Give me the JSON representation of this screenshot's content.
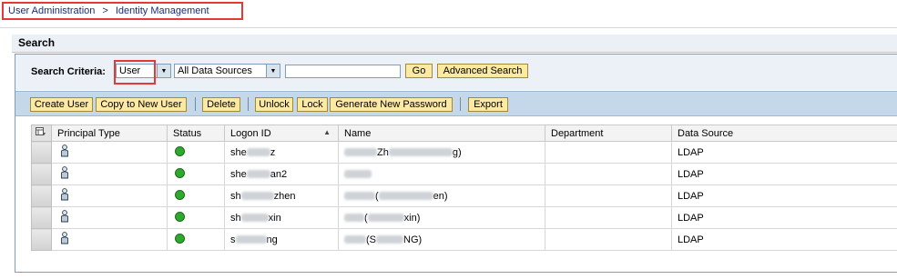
{
  "breadcrumb": {
    "item1": "User Administration",
    "separator": ">",
    "item2": "Identity Management"
  },
  "search_section": {
    "title": "Search"
  },
  "criteria": {
    "label": "Search Criteria:",
    "type_value": "User",
    "source_value": "All Data Sources",
    "search_value": "",
    "go_label": "Go",
    "advanced_label": "Advanced Search"
  },
  "toolbar": {
    "create_user": "Create User",
    "copy_user": "Copy to New User",
    "delete": "Delete",
    "unlock": "Unlock",
    "lock": "Lock",
    "generate_password": "Generate New Password",
    "export": "Export"
  },
  "table": {
    "columns": [
      "Principal Type",
      "Status",
      "Logon ID",
      "Name",
      "Department",
      "Data Source"
    ],
    "rows": [
      {
        "logon": [
          "she",
          "z"
        ],
        "name": [
          "",
          "Zh",
          "g)"
        ],
        "department": "",
        "source": "LDAP"
      },
      {
        "logon": [
          "she",
          "an2"
        ],
        "name": [
          "",
          "",
          ""
        ],
        "department": "",
        "source": "LDAP"
      },
      {
        "logon": [
          "sh",
          "zhen"
        ],
        "name": [
          "",
          "(",
          "en)"
        ],
        "department": "",
        "source": "LDAP"
      },
      {
        "logon": [
          "sh",
          "xin"
        ],
        "name": [
          "",
          "(",
          "xin)"
        ],
        "department": "",
        "source": "LDAP"
      },
      {
        "logon": [
          "s",
          "ng"
        ],
        "name": [
          "",
          "(S",
          "NG)"
        ],
        "department": "",
        "source": "LDAP"
      }
    ]
  },
  "colors": {
    "status_ok": "#2ea82e",
    "button_bg": "#fdeaa2",
    "highlight": "#e53935"
  }
}
